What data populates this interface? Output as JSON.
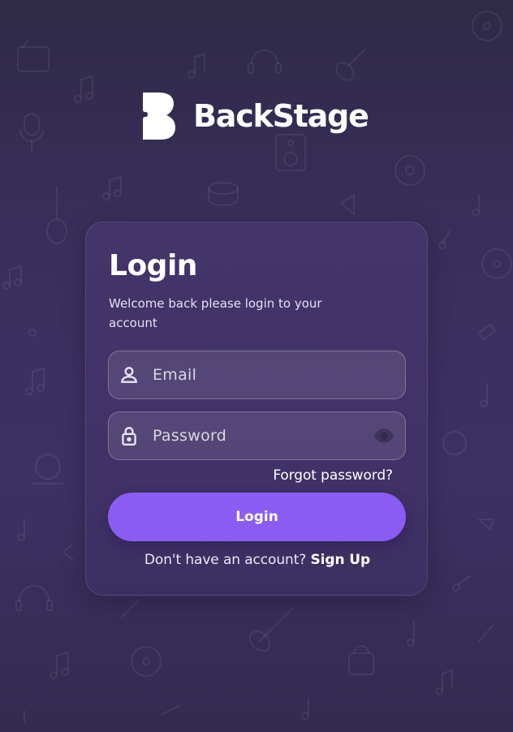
{
  "brand": {
    "name": "BackStage",
    "logo_icon": "backstage-b-logo-icon"
  },
  "login_card": {
    "title": "Login",
    "subtitle": "Welcome back please login to your account",
    "email": {
      "placeholder": "Email",
      "value": "",
      "icon": "person-icon"
    },
    "password": {
      "placeholder": "Password",
      "value": "",
      "icon": "lock-icon",
      "toggle_icon": "eye-icon"
    },
    "forgot_password_label": "Forgot password?",
    "login_button_label": "Login",
    "signup_prompt": "Don't have an account?",
    "signup_link_label": "Sign Up"
  },
  "theme": {
    "accent": "#8A5CF2",
    "background": "#3A2F5C",
    "card": "#46376E"
  },
  "background_pattern": {
    "style": "music-doodle-icons"
  }
}
